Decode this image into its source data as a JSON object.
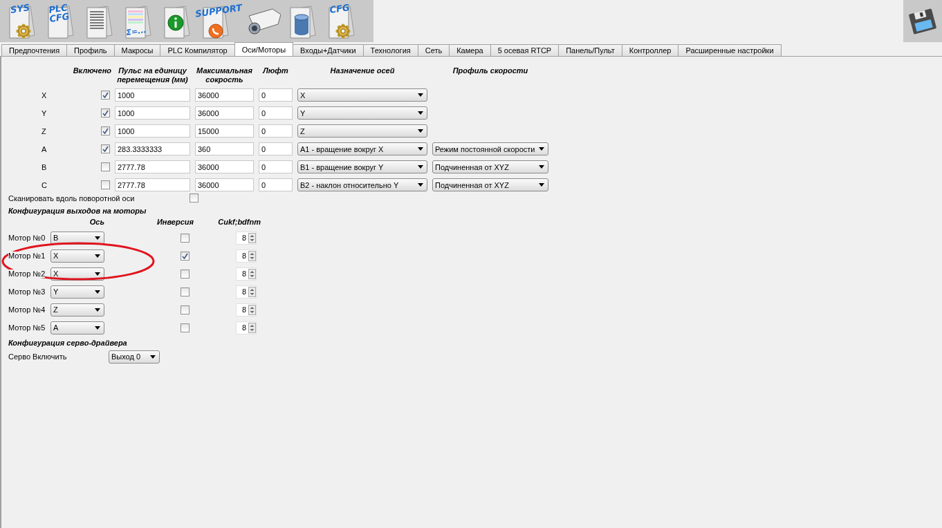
{
  "toolbar": [
    {
      "kind": "gear-doc",
      "label": "SYS"
    },
    {
      "kind": "doc",
      "label": "PLC CFG"
    },
    {
      "kind": "lines-doc"
    },
    {
      "kind": "table-doc",
      "label": "Σ=..."
    },
    {
      "kind": "info-doc"
    },
    {
      "kind": "support",
      "label": "SUPPORT"
    },
    {
      "kind": "camera"
    },
    {
      "kind": "database-doc"
    },
    {
      "kind": "gear-doc",
      "label": "CFG"
    }
  ],
  "tabs": [
    {
      "label": "Предпочтения",
      "selected": false
    },
    {
      "label": "Профиль",
      "selected": false
    },
    {
      "label": "Макросы",
      "selected": false
    },
    {
      "label": "PLC Компилятор",
      "selected": false
    },
    {
      "label": "Оси/Моторы",
      "selected": true
    },
    {
      "label": "Входы+Датчики",
      "selected": false
    },
    {
      "label": "Технология",
      "selected": false
    },
    {
      "label": "Сеть",
      "selected": false
    },
    {
      "label": "Камера",
      "selected": false
    },
    {
      "label": "5 осевая RTCP",
      "selected": false
    },
    {
      "label": "Панель/Пульт",
      "selected": false
    },
    {
      "label": "Контроллер",
      "selected": false
    },
    {
      "label": "Расширенные настройки",
      "selected": false
    }
  ],
  "axes": {
    "headers": {
      "enabled": "Включено",
      "pulse": "Пульс на единицу перемещения (мм)",
      "max_speed": "Максимальная сокрость",
      "backlash": "Люфт",
      "assignment": "Назначение осей",
      "profile": "Профиль скорости"
    },
    "rows": [
      {
        "name": "X",
        "enabled": true,
        "pulse": "1000",
        "max_speed": "36000",
        "backlash": "0",
        "assignment": "X"
      },
      {
        "name": "Y",
        "enabled": true,
        "pulse": "1000",
        "max_speed": "36000",
        "backlash": "0",
        "assignment": "Y"
      },
      {
        "name": "Z",
        "enabled": true,
        "pulse": "1000",
        "max_speed": "15000",
        "backlash": "0",
        "assignment": "Z"
      },
      {
        "name": "A",
        "enabled": true,
        "pulse": "283.3333333",
        "max_speed": "360",
        "backlash": "0",
        "assignment": "A1 - вращение вокруг X",
        "profile": "Режим постоянной скорости"
      },
      {
        "name": "B",
        "enabled": false,
        "pulse": "2777.78",
        "max_speed": "36000",
        "backlash": "0",
        "assignment": "B1 - вращение вокруг Y",
        "profile": "Подчиненная от XYZ"
      },
      {
        "name": "C",
        "enabled": false,
        "pulse": "2777.78",
        "max_speed": "36000",
        "backlash": "0",
        "assignment": "B2 - наклон относительно Y",
        "profile": "Подчиненная от XYZ"
      }
    ]
  },
  "scan_rotary": {
    "label": "Сканировать вдоль поворотной оси",
    "checked": false
  },
  "motors": {
    "title": "Конфигурация выходов на моторы",
    "headers": {
      "axis": "Ось",
      "inversion": "Инверсия",
      "third": "Cukf;bdfnm"
    },
    "rows": [
      {
        "label": "Мотор №0",
        "axis": "B",
        "inverted": false,
        "value": "8"
      },
      {
        "label": "Мотор №1",
        "axis": "X",
        "inverted": true,
        "value": "8"
      },
      {
        "label": "Мотор №2",
        "axis": "X",
        "inverted": false,
        "value": "8"
      },
      {
        "label": "Мотор №3",
        "axis": "Y",
        "inverted": false,
        "value": "8"
      },
      {
        "label": "Мотор №4",
        "axis": "Z",
        "inverted": false,
        "value": "8"
      },
      {
        "label": "Мотор №5",
        "axis": "A",
        "inverted": false,
        "value": "8"
      }
    ]
  },
  "servo": {
    "title": "Конфигурация серво-драйвера",
    "label": "Серво Включить",
    "value": "Выход 0"
  }
}
